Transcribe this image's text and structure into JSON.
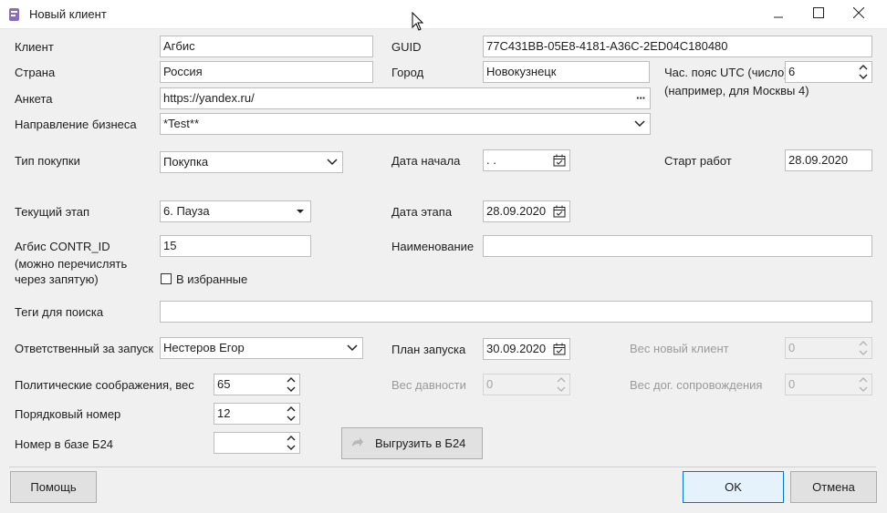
{
  "window": {
    "title": "Новый клиент"
  },
  "form": {
    "client_label": "Клиент",
    "client_value": "Агбис",
    "guid_label": "GUID",
    "guid_value": "77C431BB-05E8-4181-A36C-2ED04C180480",
    "country_label": "Страна",
    "country_value": "Россия",
    "city_label": "Город",
    "city_value": "Новокузнецк",
    "tz_label": "Час. пояс UTC (число)",
    "tz_value": "6",
    "tz_hint": "(например, для Москвы 4)",
    "survey_label": "Анкета",
    "survey_value": "https://yandex.ru/",
    "survey_dots": "···",
    "direction_label": "Направление бизнеса",
    "direction_value": "*Test**",
    "purchase_type_label": "Тип покупки",
    "purchase_type_value": "Покупка",
    "start_date_label": "Дата начала",
    "start_date_value": " .  .",
    "work_start_label": "Старт работ",
    "work_start_value": "28.09.2020",
    "stage_label": "Текущий этап",
    "stage_value": "6. Пауза",
    "stage_date_label": "Дата этапа",
    "stage_date_value": "28.09.2020",
    "contr_id_label_1": "Агбис CONTR_ID",
    "contr_id_label_2": "(можно перечислять",
    "contr_id_label_3": "через запятую)",
    "contr_id_value": "15",
    "name_label": "Наименование",
    "name_value": "",
    "favorites_label": "В избранные",
    "tags_label": "Теги для поиска",
    "tags_value": "",
    "responsible_label": "Ответственный за запуск",
    "responsible_value": "Нестеров Егор",
    "launch_plan_label": "План запуска",
    "launch_plan_value": "30.09.2020",
    "new_client_weight_label": "Вес новый клиент",
    "new_client_weight_value": "0",
    "political_label": "Политические соображения, вес",
    "political_value": "65",
    "age_weight_label": "Вес давности",
    "age_weight_value": "0",
    "support_weight_label": "Вес дог. сопровождения",
    "support_weight_value": "0",
    "order_label": "Порядковый номер",
    "order_value": "12",
    "b24_label": "Номер в базе Б24",
    "b24_value": "",
    "export_label": "Выгрузить в Б24"
  },
  "footer": {
    "help_label": "Помощь",
    "ok_label": "OK",
    "cancel_label": "Отмена"
  },
  "colors": {
    "accent": "#0078d7",
    "input_border": "#bdbdbd",
    "disabled_text": "#a5a5a5"
  }
}
